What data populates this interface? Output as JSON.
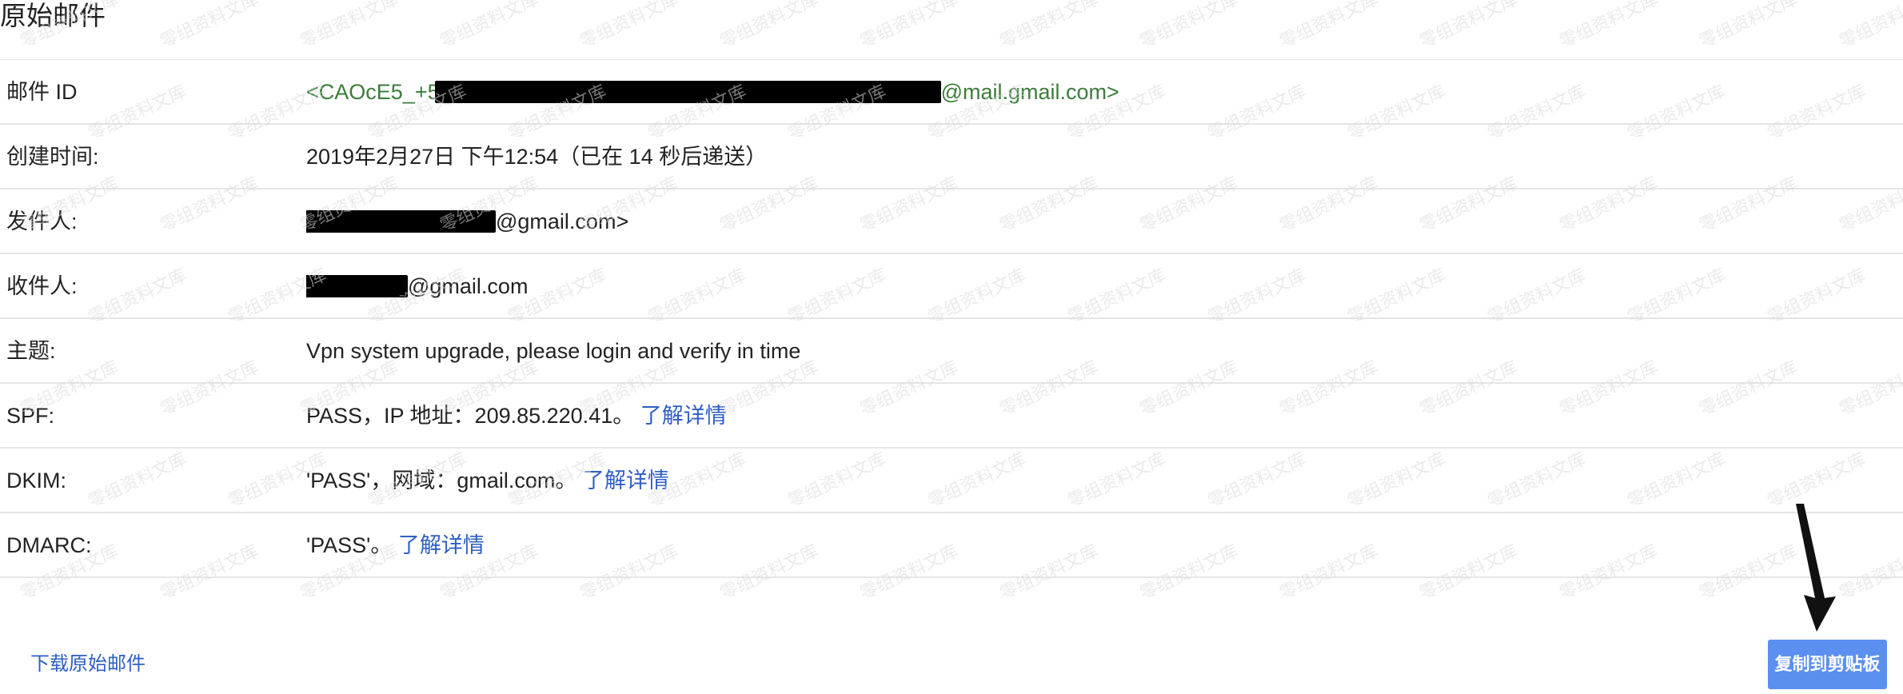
{
  "page": {
    "title": "原始邮件"
  },
  "fields": {
    "message_id": {
      "label": "邮件 ID",
      "prefix": "<CAOcE5_+5",
      "suffix": "@mail.gmail.com>"
    },
    "created": {
      "label": "创建时间:",
      "value": "2019年2月27日 下午12:54（已在 14 秒后递送）"
    },
    "from": {
      "label": "发件人:",
      "suffix": "@gmail.com>"
    },
    "to": {
      "label": "收件人:",
      "suffix": "@gmail.com"
    },
    "subject": {
      "label": "主题:",
      "value": "Vpn system upgrade, please login and verify in time"
    },
    "spf": {
      "label": "SPF:",
      "value": "PASS，IP 地址：209.85.220.41。",
      "link": "了解详情"
    },
    "dkim": {
      "label": "DKIM:",
      "value": "'PASS'，网域：gmail.com。",
      "link": "了解详情"
    },
    "dmarc": {
      "label": "DMARC:",
      "value": "'PASS'。",
      "link": "了解详情"
    }
  },
  "actions": {
    "download_label": "下载原始邮件",
    "copy_label": "复制到剪贴板"
  },
  "watermark": {
    "text": "零组资料文库"
  },
  "colors": {
    "link": "#2e5fc5",
    "message_id": "#3b7d3b",
    "copy_button": "#5b8ff0"
  }
}
